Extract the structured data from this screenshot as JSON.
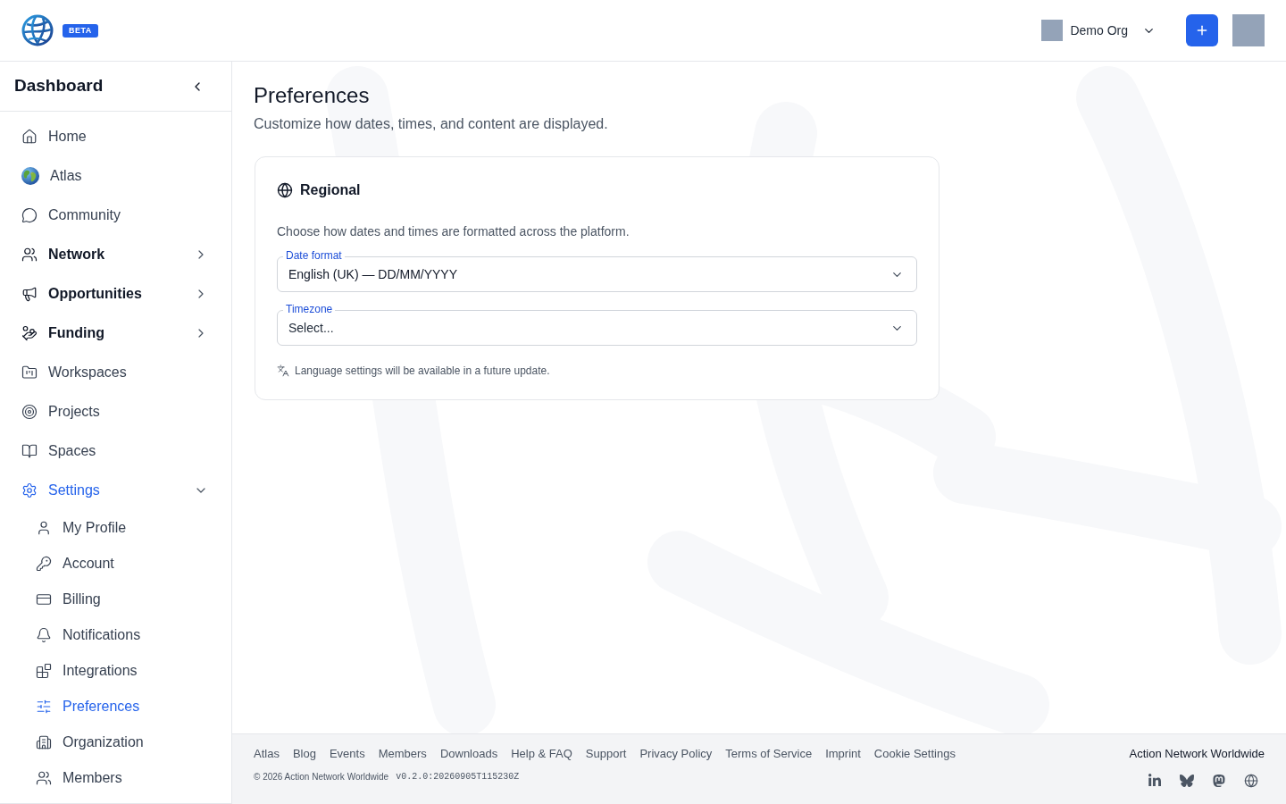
{
  "header": {
    "badge": "BETA",
    "org": {
      "name": "Demo Org"
    }
  },
  "sidebar": {
    "title": "Dashboard",
    "items": [
      {
        "label": "Home",
        "selected": false
      },
      {
        "label": "Atlas",
        "selected": false
      },
      {
        "label": "Community",
        "selected": false
      },
      {
        "label": "Network",
        "selected": false,
        "expanded": false
      },
      {
        "label": "Opportunities",
        "selected": false,
        "expanded": false
      },
      {
        "label": "Funding",
        "selected": false,
        "expanded": false
      },
      {
        "label": "Workspaces",
        "selected": false
      },
      {
        "label": "Projects",
        "selected": false
      },
      {
        "label": "Spaces",
        "selected": false
      },
      {
        "label": "Settings",
        "selected": true,
        "expanded": true,
        "children": [
          {
            "label": "My Profile",
            "selected": false
          },
          {
            "label": "Account",
            "selected": false
          },
          {
            "label": "Billing",
            "selected": false
          },
          {
            "label": "Notifications",
            "selected": false
          },
          {
            "label": "Integrations",
            "selected": false
          },
          {
            "label": "Preferences",
            "selected": true
          },
          {
            "label": "Organization",
            "selected": false
          },
          {
            "label": "Members",
            "selected": false
          }
        ]
      }
    ]
  },
  "page": {
    "title": "Preferences",
    "subtitle": "Customize how dates, times, and content are displayed."
  },
  "card": {
    "title": "Regional",
    "description": "Choose how dates and times are formatted across the platform.",
    "fields": [
      {
        "label": "Date format",
        "value": "English (UK) — DD/MM/YYYY"
      },
      {
        "label": "Timezone",
        "placeholder": "Select..."
      }
    ],
    "note": "Language settings will be available in a future update."
  },
  "footer": {
    "links": [
      "Atlas",
      "Blog",
      "Events",
      "Members",
      "Downloads",
      "Help & FAQ",
      "Support",
      "Privacy Policy",
      "Terms of Service",
      "Imprint",
      "Cookie Settings"
    ],
    "copyright": "© 2026 Action Network Worldwide",
    "version": "v0.2.0:20260905T115230Z",
    "org_name": "Action Network Worldwide"
  }
}
